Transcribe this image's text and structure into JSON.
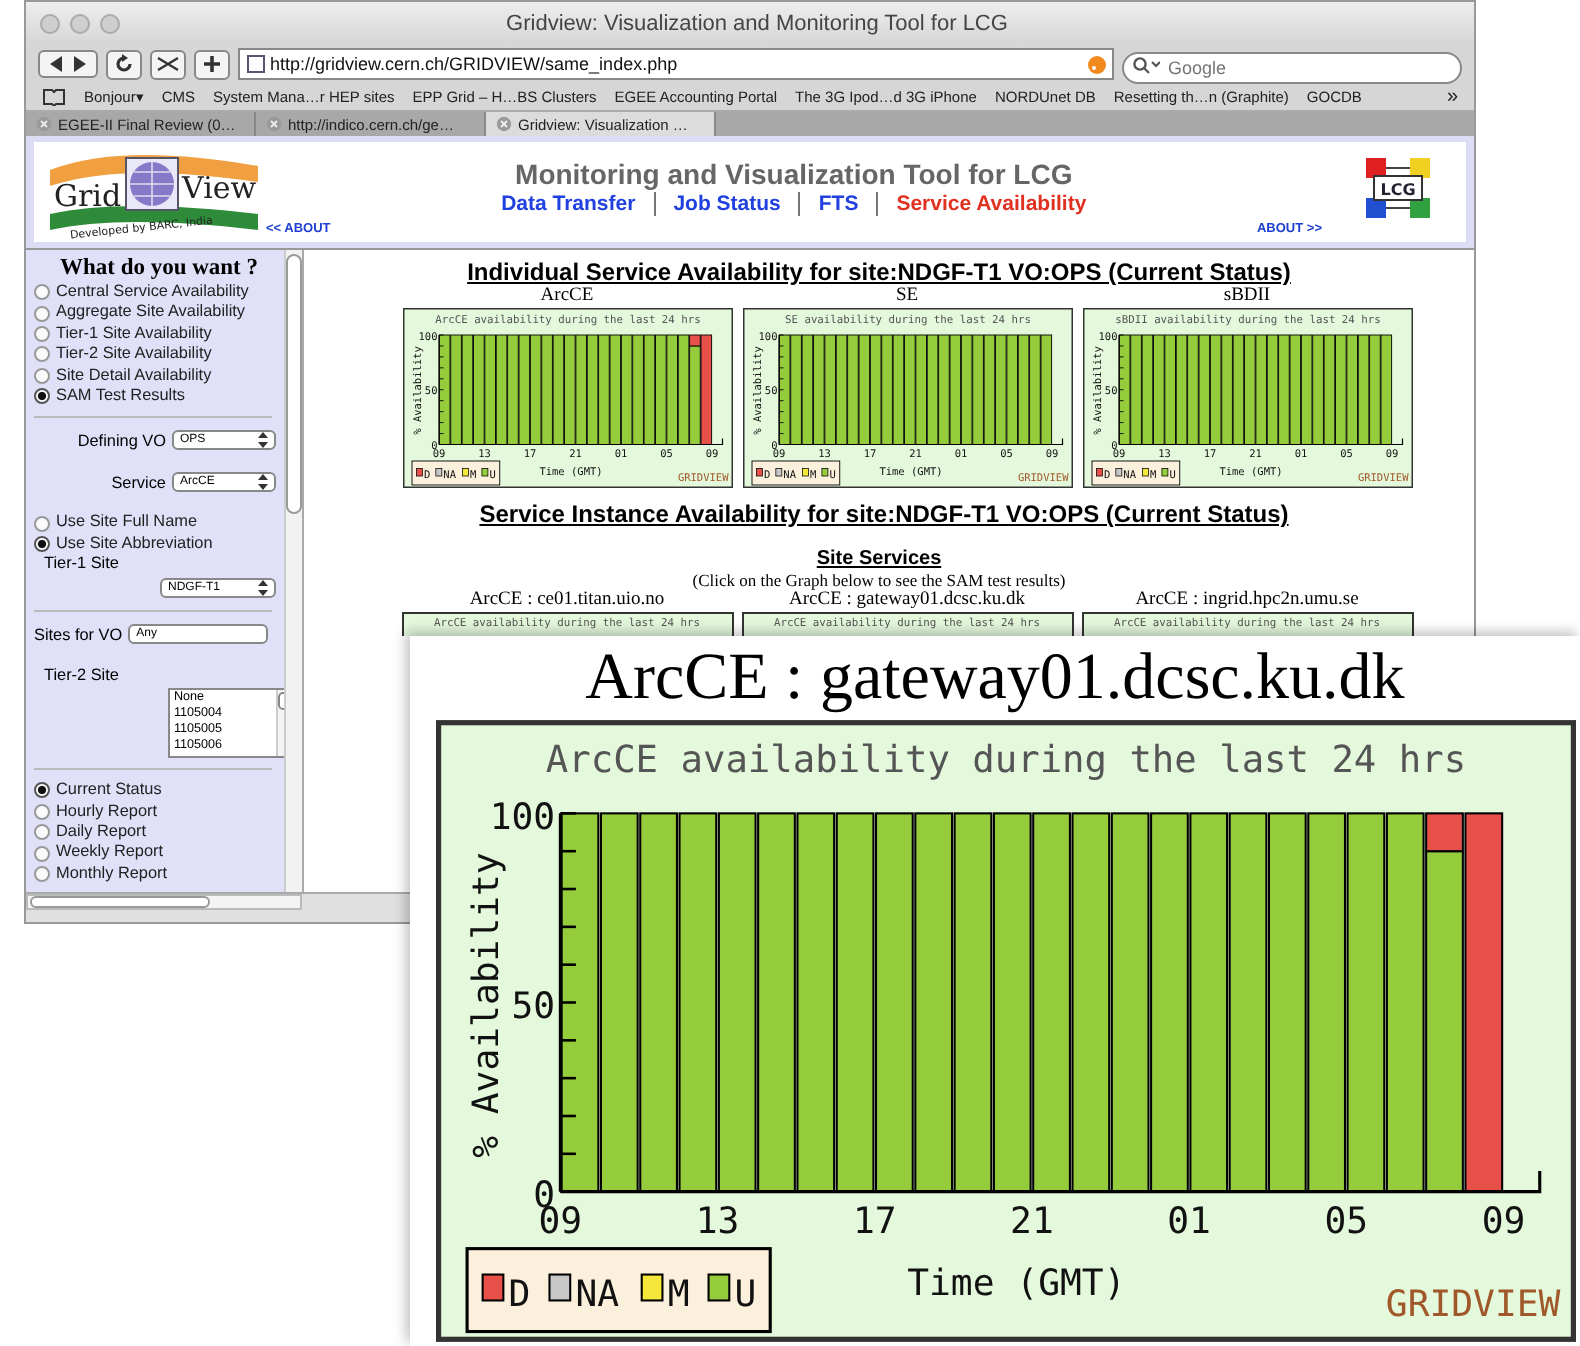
{
  "browser": {
    "title": "Gridview: Visualization and Monitoring Tool for LCG",
    "url": "http://gridview.cern.ch/GRIDVIEW/same_index.php",
    "search_placeholder": "Google",
    "bookmarks": [
      "Bonjour▾",
      "CMS",
      "System Mana…r HEP sites",
      "EPP Grid – H…BS Clusters",
      "EGEE Accounting Portal",
      "The 3G Ipod…d 3G iPhone",
      "NORDUnet DB",
      "Resetting th…n (Graphite)",
      "GOCDB"
    ],
    "overflow": "»",
    "tabs": [
      {
        "label": "EGEE-II Final Review (0…",
        "selected": false
      },
      {
        "label": "http://indico.cern.ch/ge…",
        "selected": false
      },
      {
        "label": "Gridview: Visualization …",
        "selected": true
      }
    ]
  },
  "header": {
    "logo": {
      "left_word": "Grid",
      "right_word": "View",
      "tagline": "Developed by BARC, India"
    },
    "title": "Monitoring and Visualization Tool for LCG",
    "nav": [
      {
        "label": "Data Transfer",
        "selected": false
      },
      {
        "label": "Job Status",
        "selected": false
      },
      {
        "label": "FTS",
        "selected": false
      },
      {
        "label": "Service Availability",
        "selected": true
      }
    ],
    "about_left": "<< ABOUT",
    "about_right": "ABOUT >>",
    "lcg_logo": "LCG"
  },
  "sidebar": {
    "heading": "What do you want ?",
    "views": [
      {
        "label": "Central Service Availability",
        "selected": false
      },
      {
        "label": "Aggregate Site Availability",
        "selected": false
      },
      {
        "label": "Tier-1 Site Availability",
        "selected": false
      },
      {
        "label": "Tier-2 Site Availability",
        "selected": false
      },
      {
        "label": "Site Detail Availability",
        "selected": false
      },
      {
        "label": "SAM Test Results",
        "selected": true
      }
    ],
    "vo": {
      "label": "Defining VO",
      "value": "OPS"
    },
    "service": {
      "label": "Service",
      "value": "ArcCE"
    },
    "name_modes": [
      {
        "label": "Use Site Full Name",
        "selected": false
      },
      {
        "label": "Use Site Abbreviation",
        "selected": true
      }
    ],
    "tier1": {
      "label": "Tier-1 Site",
      "value": "NDGF-T1"
    },
    "sites_for_vo": {
      "label": "Sites for VO",
      "value": "Any"
    },
    "tier2": {
      "label": "Tier-2 Site",
      "options": [
        "None",
        "1105004",
        "1105005",
        "1105006"
      ]
    },
    "reports": [
      {
        "label": "Current Status",
        "selected": true
      },
      {
        "label": "Hourly Report",
        "selected": false
      },
      {
        "label": "Daily Report",
        "selected": false
      },
      {
        "label": "Weekly Report",
        "selected": false
      },
      {
        "label": "Monthly Report",
        "selected": false
      }
    ]
  },
  "content": {
    "service_title": "Individual Service Availability for site:NDGF-T1 VO:OPS (Current Status)",
    "service_charts": [
      {
        "caption": "ArcCE",
        "credit": "GRIDVIEW",
        "end_label": "09",
        "chart_data": {
          "type": "bar",
          "stacked": true,
          "title": "ArcCE availability during the last 24 hrs",
          "xlabel": "Time (GMT)",
          "ylabel": "% Availability",
          "legend": "lower left",
          "categories": [
            "09",
            null,
            null,
            null,
            "13",
            null,
            null,
            null,
            "17",
            null,
            null,
            null,
            "21",
            null,
            null,
            null,
            "01",
            null,
            null,
            null,
            "05",
            null,
            null,
            null
          ],
          "ylim": [
            0,
            100
          ],
          "yticks": [
            0,
            50,
            100
          ],
          "series": [
            {
              "name": "D",
              "color": "#e8504a",
              "values": [
                0,
                0,
                0,
                0,
                0,
                0,
                0,
                0,
                0,
                0,
                0,
                0,
                0,
                0,
                0,
                0,
                0,
                0,
                0,
                0,
                0,
                0,
                10,
                100
              ]
            },
            {
              "name": "NA",
              "color": "#c8c8c8",
              "values": [
                0,
                0,
                0,
                0,
                0,
                0,
                0,
                0,
                0,
                0,
                0,
                0,
                0,
                0,
                0,
                0,
                0,
                0,
                0,
                0,
                0,
                0,
                0,
                0
              ]
            },
            {
              "name": "M",
              "color": "#f5e83a",
              "values": [
                0,
                0,
                0,
                0,
                0,
                0,
                0,
                0,
                0,
                0,
                0,
                0,
                0,
                0,
                0,
                0,
                0,
                0,
                0,
                0,
                0,
                0,
                0,
                0
              ]
            },
            {
              "name": "U",
              "color": "#94cc3c",
              "values": [
                100,
                100,
                100,
                100,
                100,
                100,
                100,
                100,
                100,
                100,
                100,
                100,
                100,
                100,
                100,
                100,
                100,
                100,
                100,
                100,
                100,
                100,
                90,
                0
              ]
            }
          ]
        }
      },
      {
        "caption": "SE",
        "credit": "GRIDVIEW",
        "end_label": "09",
        "chart_data": {
          "type": "bar",
          "stacked": true,
          "title": "SE availability during the last 24 hrs",
          "xlabel": "Time (GMT)",
          "ylabel": "% Availability",
          "legend": "lower left",
          "categories": [
            "09",
            null,
            null,
            null,
            "13",
            null,
            null,
            null,
            "17",
            null,
            null,
            null,
            "21",
            null,
            null,
            null,
            "01",
            null,
            null,
            null,
            "05",
            null,
            null,
            null
          ],
          "ylim": [
            0,
            100
          ],
          "yticks": [
            0,
            50,
            100
          ],
          "series": [
            {
              "name": "D",
              "color": "#e8504a",
              "values": [
                0,
                0,
                0,
                0,
                0,
                0,
                0,
                0,
                0,
                0,
                0,
                0,
                0,
                0,
                0,
                0,
                0,
                0,
                0,
                0,
                0,
                0,
                0,
                0
              ]
            },
            {
              "name": "NA",
              "color": "#c8c8c8",
              "values": [
                0,
                0,
                0,
                0,
                0,
                0,
                0,
                0,
                0,
                0,
                0,
                0,
                0,
                0,
                0,
                0,
                0,
                0,
                0,
                0,
                0,
                0,
                0,
                0
              ]
            },
            {
              "name": "M",
              "color": "#f5e83a",
              "values": [
                0,
                0,
                0,
                0,
                0,
                0,
                0,
                0,
                0,
                0,
                0,
                0,
                0,
                0,
                0,
                0,
                0,
                0,
                0,
                0,
                0,
                0,
                0,
                0
              ]
            },
            {
              "name": "U",
              "color": "#94cc3c",
              "values": [
                100,
                100,
                100,
                100,
                100,
                100,
                100,
                100,
                100,
                100,
                100,
                100,
                100,
                100,
                100,
                100,
                100,
                100,
                100,
                100,
                100,
                100,
                100,
                100
              ]
            }
          ]
        }
      },
      {
        "caption": "sBDII",
        "credit": "GRIDVIEW",
        "end_label": "09",
        "chart_data": {
          "type": "bar",
          "stacked": true,
          "title": "sBDII availability during the last 24 hrs",
          "xlabel": "Time (GMT)",
          "ylabel": "% Availability",
          "legend": "lower left",
          "categories": [
            "09",
            null,
            null,
            null,
            "13",
            null,
            null,
            null,
            "17",
            null,
            null,
            null,
            "21",
            null,
            null,
            null,
            "01",
            null,
            null,
            null,
            "05",
            null,
            null,
            null
          ],
          "ylim": [
            0,
            100
          ],
          "yticks": [
            0,
            50,
            100
          ],
          "series": [
            {
              "name": "D",
              "color": "#e8504a",
              "values": [
                0,
                0,
                0,
                0,
                0,
                0,
                0,
                0,
                0,
                0,
                0,
                0,
                0,
                0,
                0,
                0,
                0,
                0,
                0,
                0,
                0,
                0,
                0,
                0
              ]
            },
            {
              "name": "NA",
              "color": "#c8c8c8",
              "values": [
                0,
                0,
                0,
                0,
                0,
                0,
                0,
                0,
                0,
                0,
                0,
                0,
                0,
                0,
                0,
                0,
                0,
                0,
                0,
                0,
                0,
                0,
                0,
                0
              ]
            },
            {
              "name": "M",
              "color": "#f5e83a",
              "values": [
                0,
                0,
                0,
                0,
                0,
                0,
                0,
                0,
                0,
                0,
                0,
                0,
                0,
                0,
                0,
                0,
                0,
                0,
                0,
                0,
                0,
                0,
                0,
                0
              ]
            },
            {
              "name": "U",
              "color": "#94cc3c",
              "values": [
                100,
                100,
                100,
                100,
                100,
                100,
                100,
                100,
                100,
                100,
                100,
                100,
                100,
                100,
                100,
                100,
                100,
                100,
                100,
                100,
                100,
                100,
                100,
                100
              ]
            }
          ]
        }
      }
    ],
    "instance_title": "Service Instance Availability for site:NDGF-T1 VO:OPS (Current Status)",
    "site_services": "Site Services",
    "hint": "(Click on the Graph below to see the SAM test results)",
    "instances": [
      {
        "caption": "ArcCE : ce01.titan.uio.no",
        "chart_title": "ArcCE availability during the last 24 hrs"
      },
      {
        "caption": "ArcCE : gateway01.dcsc.ku.dk",
        "chart_title": "ArcCE availability during the last 24 hrs"
      },
      {
        "caption": "ArcCE : ingrid.hpc2n.umu.se",
        "chart_title": "ArcCE availability during the last 24 hrs"
      }
    ]
  },
  "zoom_overlay": {
    "caption": "ArcCE : gateway01.dcsc.ku.dk",
    "credit": "GRIDVIEW",
    "end_label": "09",
    "chart_data": {
      "type": "bar",
      "stacked": true,
      "title": "ArcCE availability during the last 24 hrs",
      "xlabel": "Time (GMT)",
      "ylabel": "% Availability",
      "legend": "lower left",
      "categories": [
        "09",
        null,
        null,
        null,
        "13",
        null,
        null,
        null,
        "17",
        null,
        null,
        null,
        "21",
        null,
        null,
        null,
        "01",
        null,
        null,
        null,
        "05",
        null,
        null,
        null
      ],
      "ylim": [
        0,
        100
      ],
      "yticks": [
        0,
        50,
        100
      ],
      "series": [
        {
          "name": "D",
          "color": "#e8504a",
          "values": [
            0,
            0,
            0,
            0,
            0,
            0,
            0,
            0,
            0,
            0,
            0,
            0,
            0,
            0,
            0,
            0,
            0,
            0,
            0,
            0,
            0,
            0,
            10,
            100
          ]
        },
        {
          "name": "NA",
          "color": "#c8c8c8",
          "values": [
            0,
            0,
            0,
            0,
            0,
            0,
            0,
            0,
            0,
            0,
            0,
            0,
            0,
            0,
            0,
            0,
            0,
            0,
            0,
            0,
            0,
            0,
            0,
            0
          ]
        },
        {
          "name": "M",
          "color": "#f5e83a",
          "values": [
            0,
            0,
            0,
            0,
            0,
            0,
            0,
            0,
            0,
            0,
            0,
            0,
            0,
            0,
            0,
            0,
            0,
            0,
            0,
            0,
            0,
            0,
            0,
            0
          ]
        },
        {
          "name": "U",
          "color": "#94cc3c",
          "values": [
            100,
            100,
            100,
            100,
            100,
            100,
            100,
            100,
            100,
            100,
            100,
            100,
            100,
            100,
            100,
            100,
            100,
            100,
            100,
            100,
            100,
            100,
            90,
            0
          ]
        }
      ]
    }
  }
}
